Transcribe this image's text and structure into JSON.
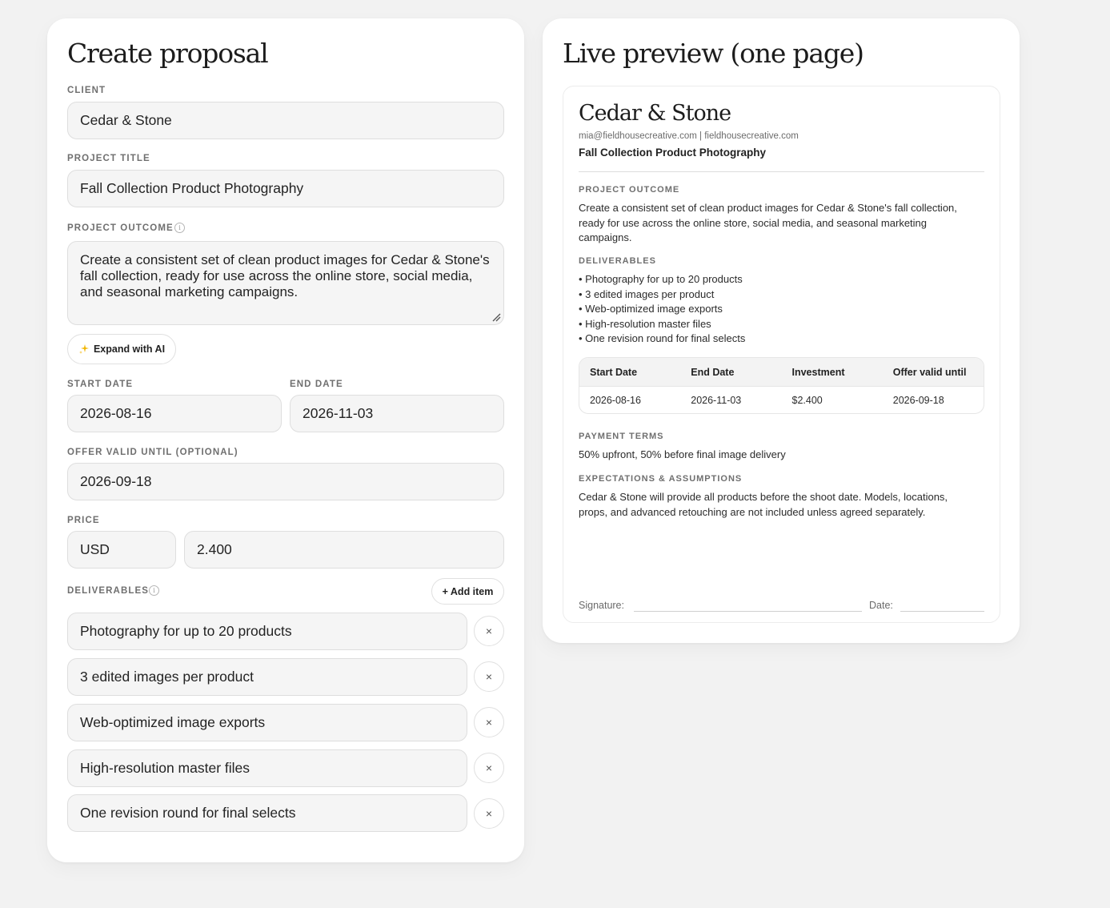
{
  "form": {
    "title": "Create proposal",
    "client_label": "CLIENT",
    "client_value": "Cedar & Stone",
    "project_title_label": "PROJECT TITLE",
    "project_title_value": "Fall Collection Product Photography",
    "outcome_label": "PROJECT OUTCOME",
    "outcome_value": "Create a consistent set of clean product images for Cedar & Stone's fall collection, ready for use across the online store, social media, and seasonal marketing campaigns.",
    "expand_ai_label": "Expand with AI",
    "start_date_label": "START DATE",
    "start_date_value": "2026-08-16",
    "end_date_label": "END DATE",
    "end_date_value": "2026-11-03",
    "offer_valid_label": "OFFER VALID UNTIL (OPTIONAL)",
    "offer_valid_value": "2026-09-18",
    "price_label": "PRICE",
    "currency_value": "USD",
    "price_value": "2.400",
    "deliverables_label": "DELIVERABLES",
    "add_item_label": "+ Add item",
    "deliverables": [
      "Photography for up to 20 products",
      "3 edited images per product",
      "Web-optimized image exports",
      "High-resolution master files",
      "One revision round for final selects"
    ],
    "remove_symbol": "×",
    "info_symbol": "i"
  },
  "preview": {
    "title": "Live preview (one page)",
    "client": "Cedar & Stone",
    "contact": "mia@fieldhousecreative.com | fieldhousecreative.com",
    "project": "Fall Collection Product Photography",
    "outcome_label": "PROJECT OUTCOME",
    "outcome_text": "Create a consistent set of clean product images for Cedar & Stone's fall collection, ready for use across the online store, social media, and seasonal marketing campaigns.",
    "deliverables_label": "DELIVERABLES",
    "deliverables": [
      "• Photography for up to 20 products",
      "• 3 edited images per product",
      "• Web-optimized image exports",
      "• High-resolution master files",
      "• One revision round for final selects"
    ],
    "table_headers": [
      "Start Date",
      "End Date",
      "Investment",
      "Offer valid until"
    ],
    "table_values": [
      "2026-08-16",
      "2026-11-03",
      "$2.400",
      "2026-09-18"
    ],
    "payment_label": "PAYMENT TERMS",
    "payment_text": "50% upfront, 50% before final image delivery",
    "expectations_label": "EXPECTATIONS & ASSUMPTIONS",
    "expectations_text": "Cedar & Stone will provide all products before the shoot date. Models, locations, props, and advanced retouching are not included unless agreed separately.",
    "signature_label": "Signature:",
    "date_label": "Date:"
  },
  "colors": {
    "background": "#f2f2f2",
    "card": "#ffffff",
    "field": "#f5f5f5",
    "accent_icon": "#f2b705"
  }
}
